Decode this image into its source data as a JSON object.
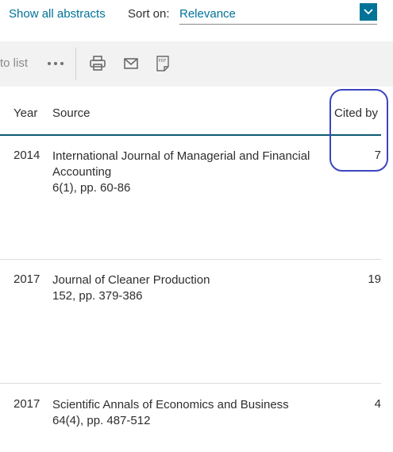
{
  "topbar": {
    "show_abstracts": "Show all abstracts",
    "sort_label": "Sort on:",
    "sort_value": "Relevance"
  },
  "toolbar": {
    "add_to_list": "to list",
    "icons": [
      "more-icon",
      "print-icon",
      "email-icon",
      "pdf-icon"
    ]
  },
  "table": {
    "headers": {
      "year": "Year",
      "source": "Source",
      "cited_by": "Cited by"
    },
    "rows": [
      {
        "year": "2014",
        "title": "International Journal of Managerial and Financial Accounting",
        "detail": "6(1), pp. 60-86",
        "cited": "7"
      },
      {
        "year": "2017",
        "title": "Journal of Cleaner Production",
        "detail": "152, pp. 379-386",
        "cited": "19"
      },
      {
        "year": "2017",
        "title": "Scientific Annals of Economics and Business",
        "detail": "64(4), pp. 487-512",
        "cited": "4"
      }
    ]
  },
  "colors": {
    "link": "#007398",
    "accent_rule": "#0c5a73",
    "highlight": "#3b45c0",
    "toolbar_bg": "#f2f2f2"
  }
}
